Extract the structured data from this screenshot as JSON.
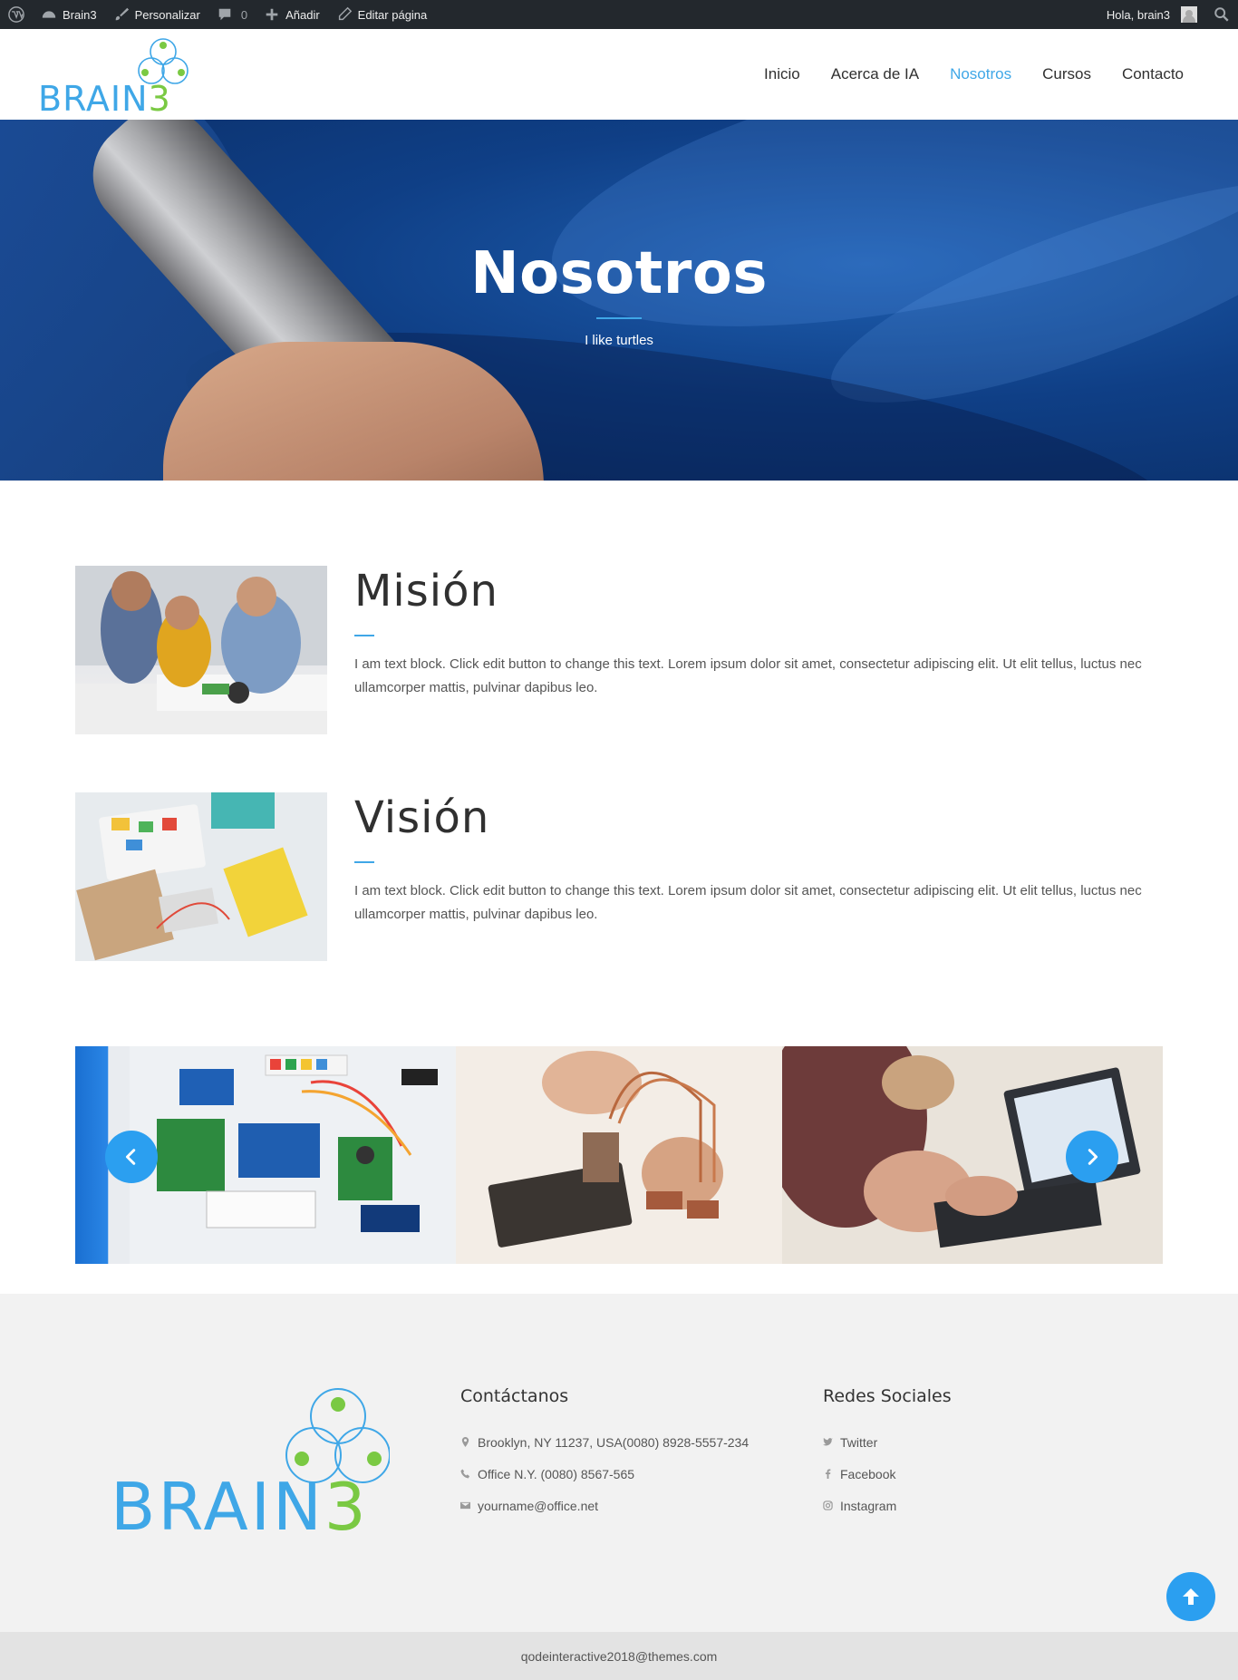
{
  "adminbar": {
    "site_name": "Brain3",
    "customize": "Personalizar",
    "comments_count": "0",
    "new": "Añadir",
    "edit_page": "Editar página",
    "greeting": "Hola, brain3"
  },
  "header": {
    "logo_text": "BRAIN3",
    "nav": [
      {
        "label": "Inicio"
      },
      {
        "label": "Acerca de IA"
      },
      {
        "label": "Nosotros",
        "active": true
      },
      {
        "label": "Cursos"
      },
      {
        "label": "Contacto"
      }
    ]
  },
  "hero": {
    "title": "Nosotros",
    "subtitle": "I like turtles"
  },
  "mission": {
    "title": "Misión",
    "text": "I am text block. Click edit button to change this text. Lorem ipsum dolor sit amet, consectetur adipiscing elit. Ut elit tellus, luctus nec ullamcorper mattis, pulvinar dapibus leo."
  },
  "vision": {
    "title": "Visión",
    "text": "I am text block. Click edit button to change this text. Lorem ipsum dolor sit amet, consectetur adipiscing elit. Ut elit tellus, luctus nec ullamcorper mattis, pulvinar dapibus leo."
  },
  "footer": {
    "logo_text": "BRAIN3",
    "contact": {
      "heading": "Contáctanos",
      "address": "Brooklyn, NY 11237, USA(0080) 8928-5557-234",
      "phone": "Office N.Y. (0080) 8567-565",
      "email": "yourname@office.net"
    },
    "social": {
      "heading": "Redes Sociales",
      "twitter": "Twitter",
      "facebook": "Facebook",
      "instagram": "Instagram"
    },
    "copyright": "qodeinteractive2018@themes.com"
  },
  "colors": {
    "accent": "#3fa7e7",
    "logo_blue": "#3fa7e7",
    "logo_green": "#7ac943",
    "adminbar_bg": "#23282d",
    "footer_bg": "#f2f2f2"
  }
}
